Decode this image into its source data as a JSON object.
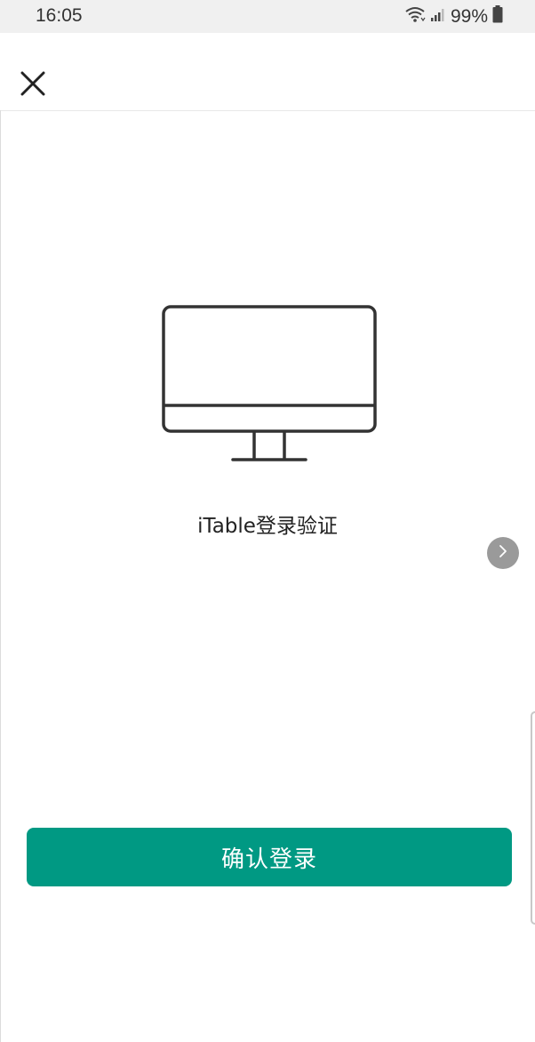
{
  "status_bar": {
    "time": "16:05",
    "battery_percent": "99%",
    "wifi_icon": "wifi-icon",
    "signal_icon": "signal-icon",
    "battery_icon": "battery-icon"
  },
  "header": {
    "close_icon": "close-icon"
  },
  "main": {
    "illustration_icon": "desktop-monitor-icon",
    "title": "iTable登录验证",
    "float_button_icon": "chevron-right-icon"
  },
  "actions": {
    "confirm_label": "确认登录"
  },
  "colors": {
    "accent": "#009983",
    "status_bar_bg": "#f0f0f0",
    "float_button_bg": "#9a9a9a"
  }
}
